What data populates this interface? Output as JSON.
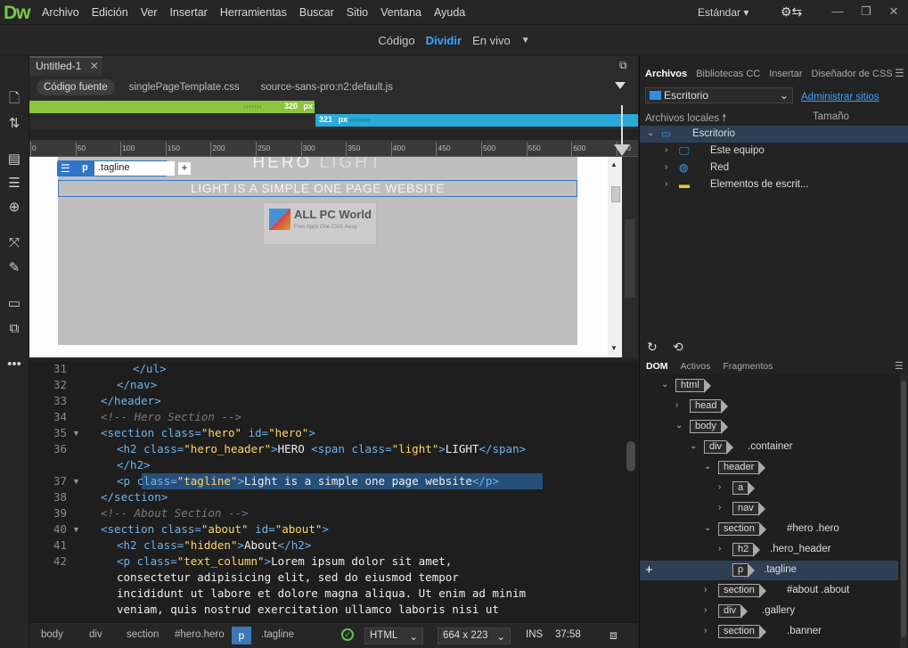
{
  "app": {
    "logo": "Dw",
    "menu": [
      "Archivo",
      "Edición",
      "Ver",
      "Insertar",
      "Herramientas",
      "Buscar",
      "Sitio",
      "Ventana",
      "Ayuda"
    ],
    "workspace": "Estándar"
  },
  "view_modes": {
    "code": "Código",
    "split": "Dividir",
    "live": "En vivo",
    "active": "Dividir"
  },
  "document": {
    "tab": "Untitled-1",
    "related_files": [
      "Código fuente",
      "singlePageTemplate.css",
      "source-sans-pro:n2:default.js"
    ]
  },
  "media_queries": {
    "green_label": "320",
    "blue_label": "321",
    "unit": "px"
  },
  "ruler": [
    "0",
    "50",
    "100",
    "150",
    "200",
    "250",
    "300",
    "350",
    "400",
    "450",
    "500",
    "550",
    "600",
    "650"
  ],
  "design_view": {
    "hero_title_main": "HERO",
    "hero_title_light": "LIGHT",
    "tagline": "LIGHT IS A SIMPLE ONE PAGE WEBSITE",
    "hud_tag": "p",
    "hud_class": ".tagline",
    "hud_add": "+",
    "watermark_title": "ALL PC World",
    "watermark_sub": "Free Apps One Click Away"
  },
  "code_lines": [
    {
      "n": "31",
      "indent": 4,
      "parts": [
        [
          "tg",
          "</ul>"
        ]
      ]
    },
    {
      "n": "32",
      "indent": 2,
      "parts": [
        [
          "tg",
          "</nav>"
        ]
      ]
    },
    {
      "n": "33",
      "indent": 0,
      "parts": [
        [
          "tg",
          "</header>"
        ]
      ]
    },
    {
      "n": "34",
      "indent": 0,
      "parts": [
        [
          "cm",
          "<!-- Hero Section -->"
        ]
      ]
    },
    {
      "n": "35",
      "indent": 0,
      "fold": true,
      "parts": [
        [
          "tg",
          "<section "
        ],
        [
          "at",
          "class="
        ],
        [
          "sv",
          "\"hero\""
        ],
        [
          "at",
          " id="
        ],
        [
          "sv",
          "\"hero\""
        ],
        [
          "tg",
          ">"
        ]
      ]
    },
    {
      "n": "36",
      "indent": 2,
      "parts": [
        [
          "tg",
          "<h2 "
        ],
        [
          "at",
          "class="
        ],
        [
          "sv",
          "\"hero_header\""
        ],
        [
          "tg",
          ">"
        ],
        [
          "tx",
          "HERO "
        ],
        [
          "tg",
          "<span "
        ],
        [
          "at",
          "class="
        ],
        [
          "sv",
          "\"light\""
        ],
        [
          "tg",
          ">"
        ],
        [
          "tx",
          "LIGHT"
        ],
        [
          "tg",
          "</span>"
        ]
      ]
    },
    {
      "n": "",
      "indent": 2,
      "parts": [
        [
          "tg",
          "</h2>"
        ]
      ]
    },
    {
      "n": "37",
      "indent": 2,
      "fold": true,
      "parts": [
        [
          "tg",
          "<p "
        ],
        [
          "at",
          "class="
        ],
        [
          "sv",
          "\"tagline\""
        ],
        [
          "tg",
          ">"
        ],
        [
          "tx",
          "Light is a simple one page website"
        ],
        [
          "tg",
          "</p>"
        ]
      ]
    },
    {
      "n": "38",
      "indent": 0,
      "parts": [
        [
          "tg",
          "</section>"
        ]
      ]
    },
    {
      "n": "39",
      "indent": 0,
      "parts": [
        [
          "cm",
          "<!-- About Section -->"
        ]
      ]
    },
    {
      "n": "40",
      "indent": 0,
      "fold": true,
      "parts": [
        [
          "tg",
          "<section "
        ],
        [
          "at",
          "class="
        ],
        [
          "sv",
          "\"about\""
        ],
        [
          "at",
          " id="
        ],
        [
          "sv",
          "\"about\""
        ],
        [
          "tg",
          ">"
        ]
      ]
    },
    {
      "n": "41",
      "indent": 2,
      "parts": [
        [
          "tg",
          "<h2 "
        ],
        [
          "at",
          "class="
        ],
        [
          "sv",
          "\"hidden\""
        ],
        [
          "tg",
          ">"
        ],
        [
          "tx",
          "About"
        ],
        [
          "tg",
          "</h2>"
        ]
      ]
    },
    {
      "n": "42",
      "indent": 2,
      "parts": [
        [
          "tg",
          "<p "
        ],
        [
          "at",
          "class="
        ],
        [
          "sv",
          "\"text_column\""
        ],
        [
          "tg",
          ">"
        ],
        [
          "tx",
          "Lorem ipsum dolor sit amet,"
        ]
      ]
    },
    {
      "n": "",
      "indent": 2,
      "parts": [
        [
          "tx",
          "consectetur adipisicing elit, sed do eiusmod tempor"
        ]
      ]
    },
    {
      "n": "",
      "indent": 2,
      "parts": [
        [
          "tx",
          "incididunt ut labore et dolore magna aliqua. Ut enim ad minim"
        ]
      ]
    },
    {
      "n": "",
      "indent": 2,
      "parts": [
        [
          "tx",
          "veniam, quis nostrud exercitation ullamco laboris nisi ut"
        ]
      ]
    }
  ],
  "status_bar": {
    "crumbs": [
      "body",
      "div",
      "section",
      "#hero.hero"
    ],
    "current_tag": "p",
    "current_class": ".tagline",
    "language": "HTML",
    "size": "664 x 223",
    "mode": "INS",
    "position": "37:58"
  },
  "files_panel": {
    "tabs": [
      "Archivos",
      "Bibliotecas CC",
      "Insertar",
      "Diseñador de CSS"
    ],
    "active_tab": "Archivos",
    "site": "Escritorio",
    "manage_link": "Administrar sitios",
    "header_local": "Archivos locales",
    "header_size": "Tamaño",
    "items": [
      {
        "name": "Escritorio",
        "level": 0,
        "icon": "desktop-icon",
        "expanded": true,
        "selected": true
      },
      {
        "name": "Este equipo",
        "level": 1,
        "icon": "computer-icon"
      },
      {
        "name": "Red",
        "level": 1,
        "icon": "network-icon"
      },
      {
        "name": "Elementos de escrit...",
        "level": 1,
        "icon": "folder-icon"
      }
    ]
  },
  "dom_panel": {
    "tabs": [
      "DOM",
      "Activos",
      "Fragmentos"
    ],
    "active_tab": "DOM",
    "nodes": [
      {
        "tag": "html",
        "sel": "",
        "level": 0,
        "chev": "open"
      },
      {
        "tag": "head",
        "sel": "",
        "level": 1,
        "chev": "closed"
      },
      {
        "tag": "body",
        "sel": "",
        "level": 1,
        "chev": "open"
      },
      {
        "tag": "div",
        "sel": ".container",
        "level": 2,
        "chev": "open"
      },
      {
        "tag": "header",
        "sel": "",
        "level": 3,
        "chev": "open"
      },
      {
        "tag": "a",
        "sel": "",
        "level": 4,
        "chev": "closed"
      },
      {
        "tag": "nav",
        "sel": "",
        "level": 4,
        "chev": "closed"
      },
      {
        "tag": "section",
        "sel": "#hero .hero",
        "level": 3,
        "chev": "open"
      },
      {
        "tag": "h2",
        "sel": ".hero_header",
        "level": 4,
        "chev": "closed"
      },
      {
        "tag": "p",
        "sel": ".tagline",
        "level": 4,
        "chev": "",
        "selected": true
      },
      {
        "tag": "section",
        "sel": "#about .about",
        "level": 3,
        "chev": "closed"
      },
      {
        "tag": "div",
        "sel": ".gallery",
        "level": 3,
        "chev": "closed"
      },
      {
        "tag": "section",
        "sel": ".banner",
        "level": 3,
        "chev": "closed"
      }
    ]
  },
  "colors": {
    "accent": "#3ba3ff",
    "mq_green": "#8cc63f",
    "mq_blue": "#2aaad8",
    "logo": "#7ac74c"
  }
}
